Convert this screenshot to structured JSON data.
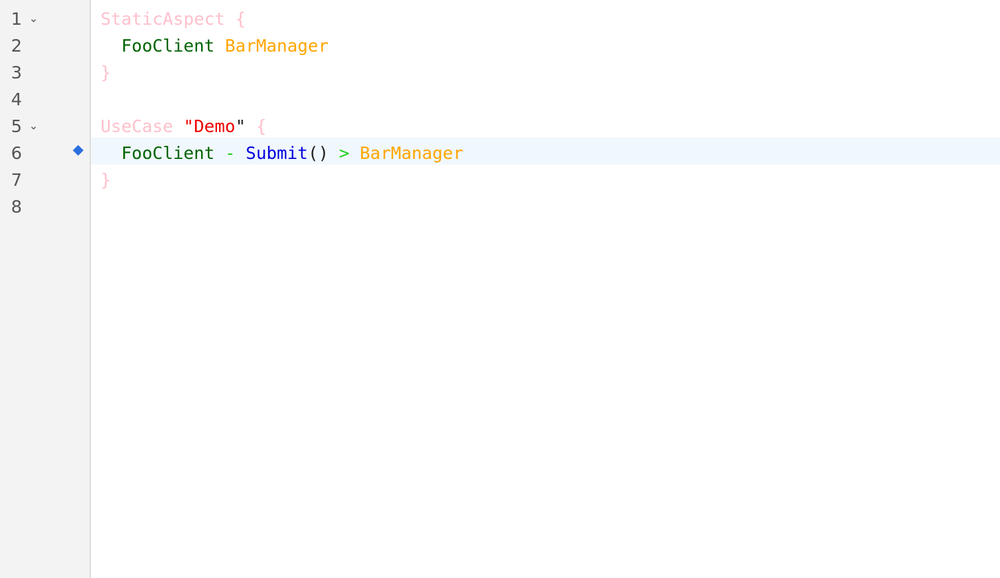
{
  "colors": {
    "keyword": "#ffc0cb",
    "identifier": "#006400",
    "target": "#ffa500",
    "string": "#ee0000",
    "method": "#0000dd",
    "operator": "#1fd01f",
    "punctuation": "#222222",
    "active_line_background": "#f0f7fd",
    "marker": "#2b6fde"
  },
  "gutter": {
    "line_numbers": [
      "1",
      "2",
      "3",
      "4",
      "5",
      "6",
      "7",
      "8"
    ],
    "fold_icon": "chevron-down-icon",
    "fold_glyph": "⌄",
    "marker_icon": "diamond-icon"
  },
  "code": {
    "line1": {
      "keyword": "StaticAspect",
      "brace": "{"
    },
    "line2": {
      "client": "FooClient",
      "manager": "BarManager"
    },
    "line3": {
      "brace": "}"
    },
    "line5": {
      "keyword": "UseCase",
      "quote_open": "\"",
      "string": "Demo",
      "quote_close": "\"",
      "brace": "{"
    },
    "line6": {
      "client": "FooClient",
      "dash": "-",
      "method": "Submit",
      "parens": "()",
      "arrow": ">",
      "manager": "BarManager"
    },
    "line7": {
      "brace": "}"
    }
  }
}
